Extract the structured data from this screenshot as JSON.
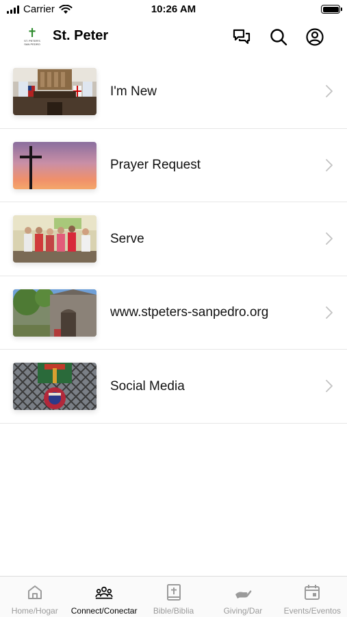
{
  "status_bar": {
    "carrier": "Carrier",
    "time": "10:26 AM"
  },
  "header": {
    "logo_text": "ST. PETER'S\nSAN PEDRO",
    "title": "St. Peter",
    "icons": [
      "chat-icon",
      "search-icon",
      "profile-icon"
    ]
  },
  "list": {
    "items": [
      {
        "label": "I'm New",
        "thumbnail": "church-interior-image"
      },
      {
        "label": "Prayer Request",
        "thumbnail": "cross-sunset-image"
      },
      {
        "label": "Serve",
        "thumbnail": "volunteers-group-image"
      },
      {
        "label": "www.stpeters-sanpedro.org",
        "thumbnail": "church-exterior-image"
      },
      {
        "label": "Social Media",
        "thumbnail": "stained-glass-image"
      }
    ]
  },
  "tab_bar": {
    "active_tab": "Connect/Conectar",
    "tabs": [
      {
        "label": "Home/Hogar",
        "icon": "home-icon"
      },
      {
        "label": "Connect/Conectar",
        "icon": "people-icon"
      },
      {
        "label": "Bible/Biblia",
        "icon": "bible-icon"
      },
      {
        "label": "Giving/Dar",
        "icon": "giving-hand-icon"
      },
      {
        "label": "Events/Eventos",
        "icon": "calendar-icon"
      }
    ]
  },
  "colors": {
    "active_tab": "#000000",
    "inactive_tab": "#9a9a9a",
    "logo_cross": "#2e8b2e",
    "divider": "#e6e6e6"
  }
}
